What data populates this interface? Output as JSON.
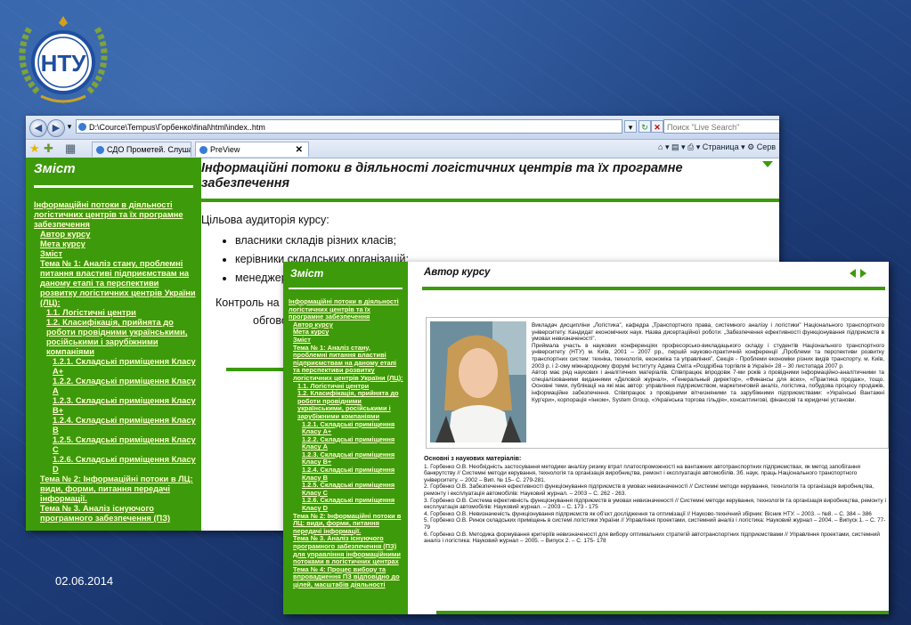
{
  "logo": {
    "text": "НТУ"
  },
  "date": "02.06.2014",
  "colors": {
    "accent_green": "#3d9a0a",
    "link_yellow": "#ffffcc",
    "slide_bg": "#1f3f78"
  },
  "browser": {
    "address": "D:\\Cource\\Tempus\\Горбенко\\final\\html\\index..htm",
    "search_placeholder": "Поиск \"Live Search\"",
    "tabs": [
      {
        "label": "СДО Прометей. Слушатели"
      },
      {
        "label": "PreView"
      }
    ],
    "tools": {
      "page": "Страница",
      "service": "Серв"
    }
  },
  "back_page": {
    "sidebar_title": "Зміст",
    "title": "Інформаційні потоки в діяльності логістичних центрів та їх програмне забезпечення",
    "audience_heading": "Цільова аудиторія курсу:",
    "audience_items": [
      "власники складів різних класів;",
      "керівники складських організацій;",
      "менеджер"
    ],
    "control_line1": "Контроль на",
    "control_line2": "обговорен"
  },
  "toc_back": [
    {
      "text": "Інформаційні потоки в діяльності логістичних центрів та їх програмне забезпечення",
      "level": 0
    },
    {
      "text": "Автор курсу",
      "level": 1
    },
    {
      "text": "Мета курсу",
      "level": 1
    },
    {
      "text": "Зміст",
      "level": 1
    },
    {
      "text": "Тема № 1: Аналіз стану, проблемні питання властиві підприємствам на даному етапі та перспективи розвитку логістичних центрів України (ЛЦ):",
      "level": 1
    },
    {
      "text": "1.1. Логістичні центри",
      "level": 2
    },
    {
      "text": "1.2. Класифікація, прийнята до роботи провідними українськими, російськими і зарубіжними компаніями",
      "level": 2
    },
    {
      "text": "1.2.1. Складські приміщення Класу А+",
      "level": 3
    },
    {
      "text": "1.2.2. Складські приміщення Класу А",
      "level": 3
    },
    {
      "text": "1.2.3. Складські приміщення Класу В+",
      "level": 3
    },
    {
      "text": "1.2.4. Складські приміщення Класу В",
      "level": 3
    },
    {
      "text": "1.2.5. Складські приміщення Класу С",
      "level": 3
    },
    {
      "text": "1.2.6. Складські приміщення Класу D",
      "level": 3
    },
    {
      "text": "Тема № 2: Інформаційні потоки в ЛЦ: види, форми, питання передачі інформації.",
      "level": 1
    },
    {
      "text": "Тема № 3. Аналіз існуючого програмного забезпечення (ПЗ)",
      "level": 1
    }
  ],
  "front_page": {
    "sidebar_title": "Зміст",
    "title": "Автор курсу",
    "toc_extra": [
      {
        "text": "Тема № 3. Аналіз існуючого програмного забезпечення (ПЗ) для управління інформаційними потоками в логістичних центрах",
        "level": 1
      },
      {
        "text": "Тема № 4: Процес вибору та впровадження ПЗ відповідно до цілей, масштабів діяльності",
        "level": 1
      }
    ],
    "bio": [
      "Викладач дисципліни „Логістика”, кафедра „Транспортного права, системного аналізу і логістики” Національного транспортного університету. Кандидат економічних наук. Назва дисертаційної роботи: „Забезпечення ефективності функціонування підприємств в умовах невизначеності”.",
      "Приймала участь в наукових конференціях професорсько-викладацького складу і студентів Національного транспортного університету (НТУ) м. Київ, 2001 – 2007 рр., першій науково-практичній конференції „Проблеми та перспективи розвитку транспортних систем: техніка, технологія, економіка та управління”, Секція - Проблеми економіки різних видів транспорту. м. Київ, 2003 р. і 2-ому міжнародному форумі Інституту Адама Сміта «Роздрібна торгівля в Україні» 28 – 30 листопада 2007 р.",
      "Автор має ряд наукових і аналітичних матеріалів. Співпрацює впродовж 7-ми років з провідними інформаційно-аналітичними та спеціалізованими виданнями «Деловой журнал», «Генеральный директор», «Финансы для всех», «Практика продаж», тощо. Основні теми, публікації на які має автор: управління підприємством, маркетинговий аналіз, логістика, побудова процесу продажів, інформаційне забезпечення. Співпрацює з провідними вітчизняними та зарубіжними підприємствами: «Українські Вантажні Кур'єри», корпорація «Інком», System Group, «Українська торгова гільдія», консалтингові, фінансові та юридичні установи."
    ],
    "pubs_title": "Основні з наукових матеріалів:",
    "pubs": [
      "1. Горбенко О.В. Необхідність застосування методики аналізу ризику втрат платоспроможності на вантажних автотранспортних підприємствах, як метод запобігання банкрутству // Системні методи керування, технологія та організація виробництва, ремонт і експлуатація автомобілів. Зб. наук. праць Національного транспортного університету. – 2002 – Вип. № 15– С. 279-281.",
      "2. Горбенко О.В. Забезпечення ефективності функціонування підприємств в умовах невизначеності // Системні методи керування, технологія та організація виробництва, ремонту і експлуатація автомобілів: Науковий журнал. – 2003 – С. 262 - 263.",
      "3. Горбенко О.В. Система ефективність функціонування підприємств в умовах невизначеності // Системні методи керування, технологія та організація виробництва, ремонту і експлуатація автомобілів: Науковий журнал. – 2003 – С. 173 - 175",
      "4. Горбенко О.В. Невизначеність функціонування підприємств як об'єкт дослідження та оптимізації // Науково-технічний збірник: Вісник НТУ. – 2003. – №8. – С. 384 – 386",
      "5. Горбенко О.В. Ринок складських приміщень в системі логістики України // Управління проектами, системний аналіз і логістика: Науковий журнал – 2004. – Випуск 1. – С. 77- 79",
      "6. Горбенко О.В. Методика формування критеріїв невизначеності для вибору оптимальних стратегій автотранспортних підприємствами // Управління проектами, системний аналіз і логістика: Науковий журнал – 2005. – Випуск 2. – С. 175- 178"
    ]
  }
}
